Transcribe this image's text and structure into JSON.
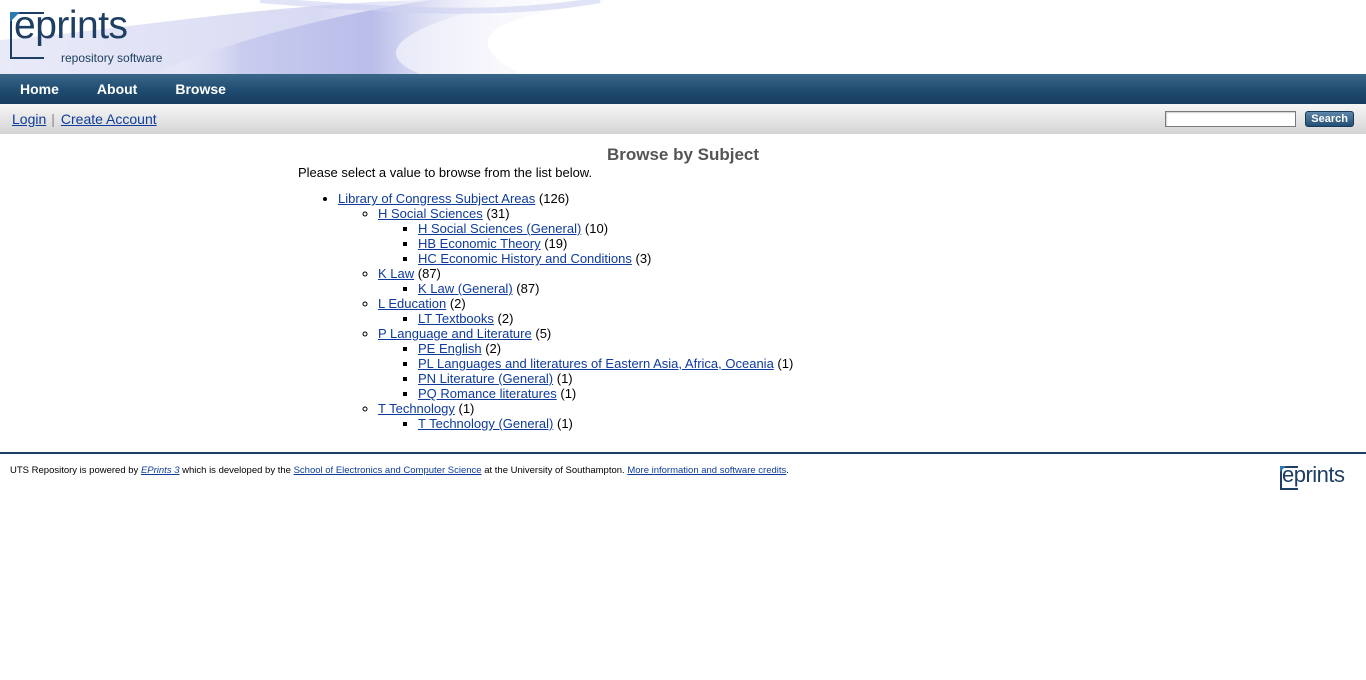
{
  "logo": {
    "wordmark": "eprints",
    "tagline": "repository software"
  },
  "nav": {
    "items": [
      "Home",
      "About",
      "Browse"
    ]
  },
  "userbar": {
    "login": "Login",
    "create_account": "Create Account",
    "search_placeholder": "",
    "search_button": "Search"
  },
  "main": {
    "title": "Browse by Subject",
    "intro": "Please select a value to browse from the list below.",
    "tree": {
      "label": "Library of Congress Subject Areas",
      "count": "(126)",
      "children": [
        {
          "label": "H Social Sciences",
          "count": "(31)",
          "children": [
            {
              "label": "H Social Sciences (General)",
              "count": "(10)"
            },
            {
              "label": "HB Economic Theory",
              "count": "(19)"
            },
            {
              "label": "HC Economic History and Conditions",
              "count": "(3)"
            }
          ]
        },
        {
          "label": "K Law",
          "count": "(87)",
          "children": [
            {
              "label": "K Law (General)",
              "count": "(87)"
            }
          ]
        },
        {
          "label": "L Education",
          "count": "(2)",
          "children": [
            {
              "label": "LT Textbooks",
              "count": "(2)"
            }
          ]
        },
        {
          "label": "P Language and Literature",
          "count": "(5)",
          "children": [
            {
              "label": "PE English",
              "count": "(2)"
            },
            {
              "label": "PL Languages and literatures of Eastern Asia, Africa, Oceania",
              "count": "(1)"
            },
            {
              "label": "PN Literature (General)",
              "count": "(1)"
            },
            {
              "label": "PQ Romance literatures",
              "count": "(1)"
            }
          ]
        },
        {
          "label": "T Technology",
          "count": "(1)",
          "children": [
            {
              "label": "T Technology (General)",
              "count": "(1)"
            }
          ]
        }
      ]
    }
  },
  "footer": {
    "text_1": "UTS Repository is powered by ",
    "link_eprints": "EPrints 3",
    "text_2": " which is developed by the ",
    "link_school": "School of Electronics and Computer Science",
    "text_3": " at the University of Southampton. ",
    "link_credits": "More information and software credits",
    "text_4": ".",
    "logo_wordmark": "eprints"
  },
  "colors": {
    "nav_bar": "#1f4b70",
    "logo_blue": "#1e3f63",
    "link": "#0f3b9c",
    "title_gray": "#555555"
  }
}
